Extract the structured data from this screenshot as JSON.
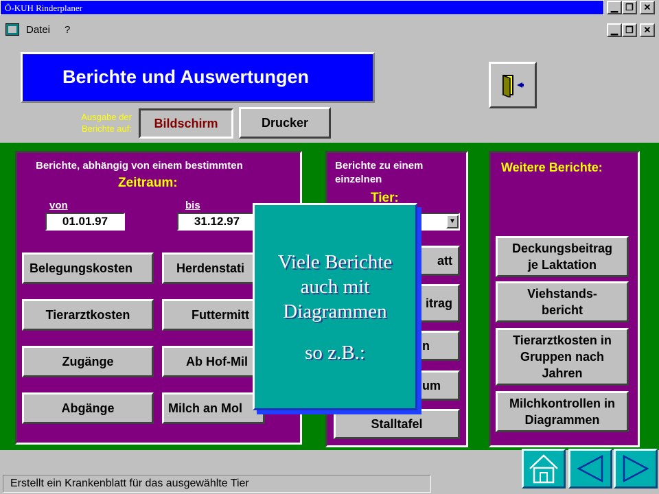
{
  "window": {
    "title": "Ö-KUH Rinderplaner",
    "controls": [
      "_",
      "▫",
      "×"
    ]
  },
  "menu": {
    "file": "Datei",
    "help": "?"
  },
  "header": {
    "title": "Berichte und Auswertungen",
    "output_label_line1": "Ausgabe der",
    "output_label_line2": "Berichte auf:",
    "screen_button": "Bildschirm",
    "printer_button": "Drucker"
  },
  "period_panel": {
    "heading": "Berichte, abhängig von einem bestimmten",
    "subheading": "Zeitraum:",
    "from_label": "von",
    "to_label": "bis",
    "from_value": "01.01.97",
    "to_value": "31.12.97",
    "buttons": [
      "Belegungskosten",
      "Herdenstati",
      "Tierarztkosten",
      "Futtermitt",
      "Zugänge",
      "Ab Hof-Mil",
      "Abgänge",
      "Milch an Mol"
    ]
  },
  "animal_panel": {
    "heading_line1": "Berichte zu einem",
    "heading_line2": "einzelnen",
    "subheading": "Tier:",
    "buttons": [
      "att",
      "itrag",
      "n",
      "um",
      "Stalltafel"
    ]
  },
  "more_panel": {
    "heading": "Weitere Berichte:",
    "buttons": [
      {
        "line1": "Deckungsbeitrag",
        "line2": "je Laktation"
      },
      {
        "line1": "Viehstands-",
        "line2": "bericht"
      },
      {
        "line1": "Tierarztkosten in",
        "line2": "Gruppen nach",
        "line3": "Jahren"
      },
      {
        "line1": "Milchkontrollen in",
        "line2": "Diagrammen"
      }
    ]
  },
  "overlay": {
    "line1": "Viele Berichte",
    "line2": "auch mit",
    "line3": "Diagrammen",
    "line4": "so z.B.:"
  },
  "status": {
    "text": "Erstellt ein Krankenblatt für das ausgewählte Tier"
  },
  "nav": {
    "home_icon": "home-icon",
    "prev_icon": "triangle-left-icon",
    "next_icon": "triangle-right-icon",
    "color": "#00b0b0"
  }
}
